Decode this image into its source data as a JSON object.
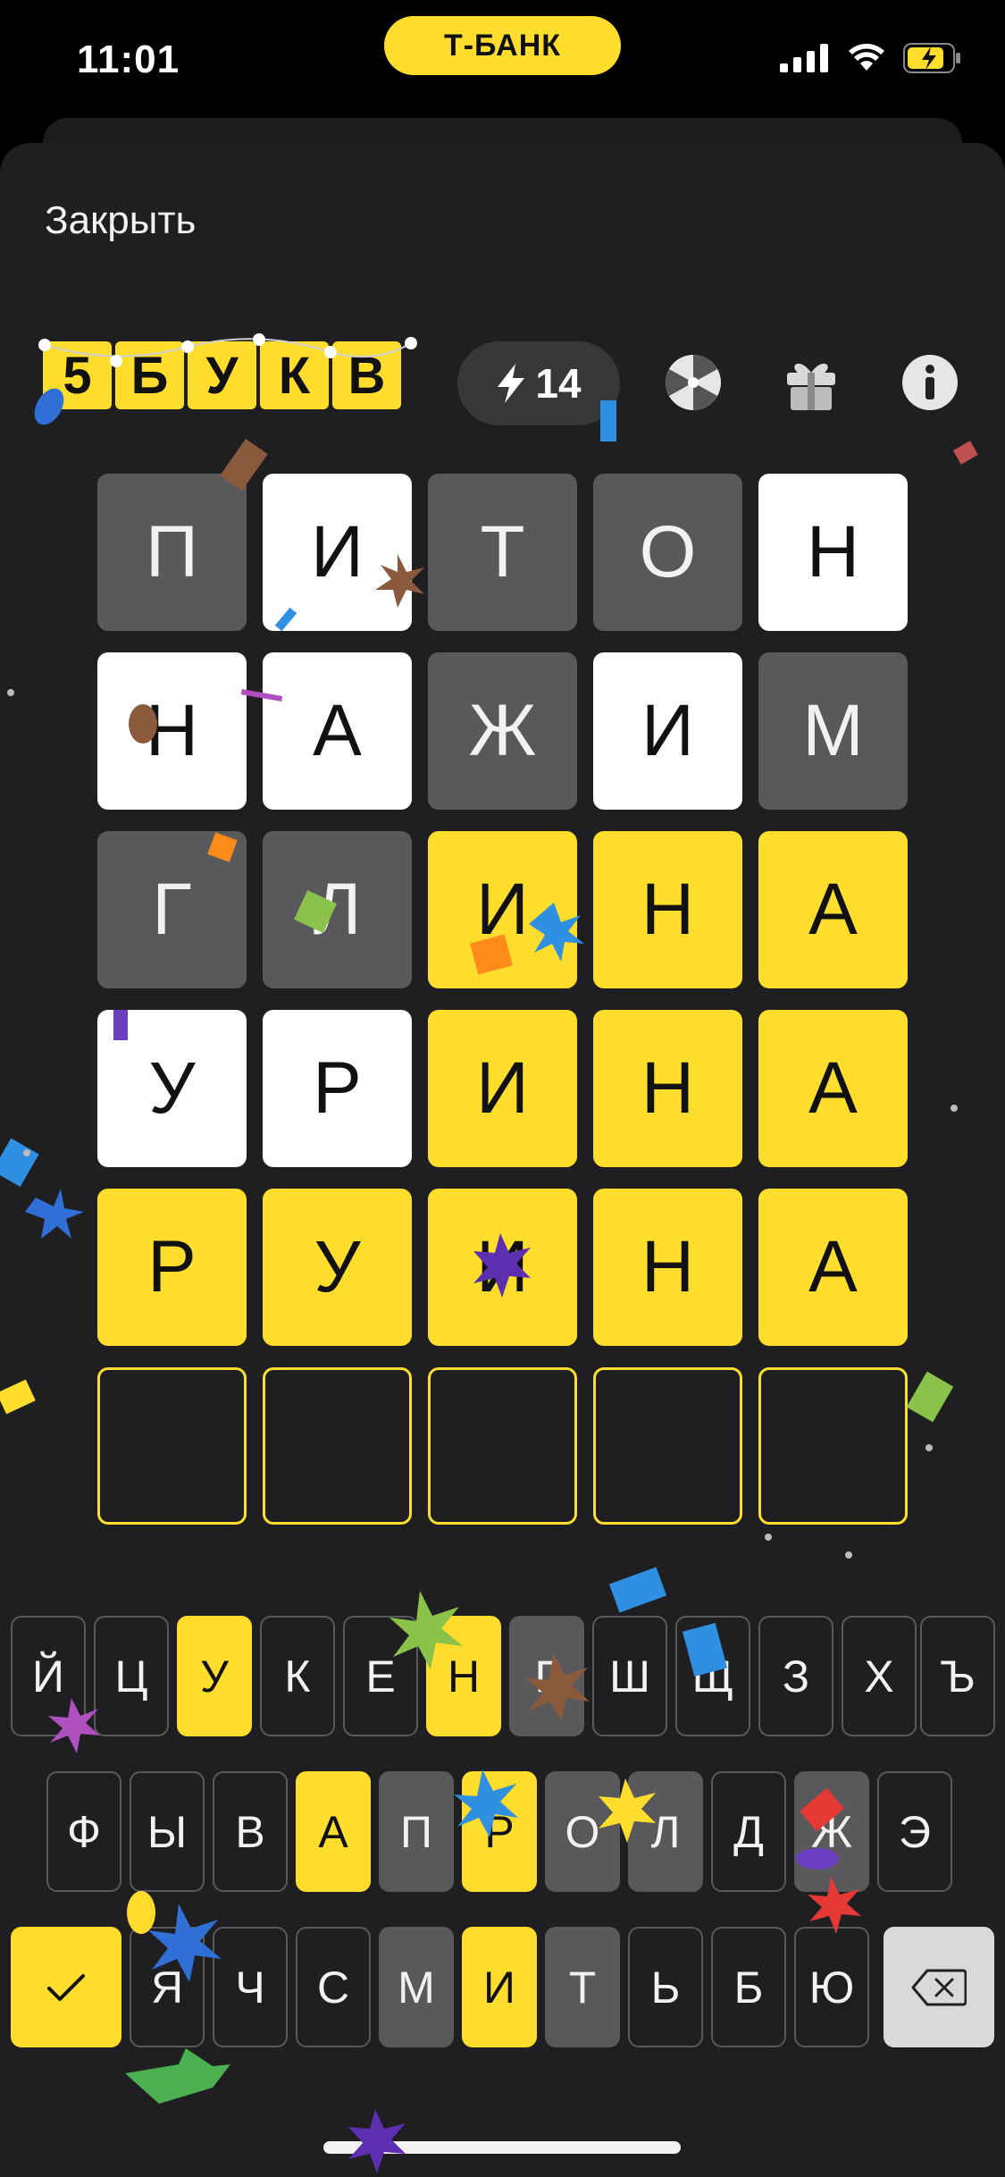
{
  "status_bar": {
    "time": "11:01",
    "bank_label": "Т-БАНК"
  },
  "sheet": {
    "close_label": "Закрыть"
  },
  "header": {
    "logo_letters": [
      "5",
      "Б",
      "У",
      "К",
      "В"
    ],
    "energy_count": "14"
  },
  "board": {
    "rows": [
      [
        {
          "letter": "П",
          "state": "gray"
        },
        {
          "letter": "И",
          "state": "white"
        },
        {
          "letter": "Т",
          "state": "gray"
        },
        {
          "letter": "О",
          "state": "gray"
        },
        {
          "letter": "Н",
          "state": "white"
        }
      ],
      [
        {
          "letter": "Н",
          "state": "white"
        },
        {
          "letter": "А",
          "state": "white"
        },
        {
          "letter": "Ж",
          "state": "gray"
        },
        {
          "letter": "И",
          "state": "white"
        },
        {
          "letter": "М",
          "state": "gray"
        }
      ],
      [
        {
          "letter": "Г",
          "state": "gray"
        },
        {
          "letter": "Л",
          "state": "gray"
        },
        {
          "letter": "И",
          "state": "yellow"
        },
        {
          "letter": "Н",
          "state": "yellow"
        },
        {
          "letter": "А",
          "state": "yellow"
        }
      ],
      [
        {
          "letter": "У",
          "state": "white"
        },
        {
          "letter": "Р",
          "state": "white"
        },
        {
          "letter": "И",
          "state": "yellow"
        },
        {
          "letter": "Н",
          "state": "yellow"
        },
        {
          "letter": "А",
          "state": "yellow"
        }
      ],
      [
        {
          "letter": "Р",
          "state": "yellow"
        },
        {
          "letter": "У",
          "state": "yellow"
        },
        {
          "letter": "И",
          "state": "yellow"
        },
        {
          "letter": "Н",
          "state": "yellow"
        },
        {
          "letter": "А",
          "state": "yellow"
        }
      ],
      [
        {
          "letter": "",
          "state": "empty"
        },
        {
          "letter": "",
          "state": "empty"
        },
        {
          "letter": "",
          "state": "empty"
        },
        {
          "letter": "",
          "state": "empty"
        },
        {
          "letter": "",
          "state": "empty"
        }
      ]
    ]
  },
  "keyboard": {
    "rows": [
      [
        {
          "label": "Й",
          "state": "normal"
        },
        {
          "label": "Ц",
          "state": "normal"
        },
        {
          "label": "У",
          "state": "yellow"
        },
        {
          "label": "К",
          "state": "normal"
        },
        {
          "label": "Е",
          "state": "normal"
        },
        {
          "label": "Н",
          "state": "yellow"
        },
        {
          "label": "Г",
          "state": "gray"
        },
        {
          "label": "Ш",
          "state": "normal"
        },
        {
          "label": "Щ",
          "state": "normal"
        },
        {
          "label": "З",
          "state": "normal"
        },
        {
          "label": "Х",
          "state": "normal"
        },
        {
          "label": "Ъ",
          "state": "normal"
        }
      ],
      [
        {
          "label": "Ф",
          "state": "normal"
        },
        {
          "label": "Ы",
          "state": "normal"
        },
        {
          "label": "В",
          "state": "normal"
        },
        {
          "label": "А",
          "state": "yellow"
        },
        {
          "label": "П",
          "state": "gray"
        },
        {
          "label": "Р",
          "state": "yellow"
        },
        {
          "label": "О",
          "state": "gray"
        },
        {
          "label": "Л",
          "state": "gray"
        },
        {
          "label": "Д",
          "state": "normal"
        },
        {
          "label": "Ж",
          "state": "gray"
        },
        {
          "label": "Э",
          "state": "normal"
        }
      ],
      [
        {
          "label": "✓",
          "state": "yellow",
          "role": "submit"
        },
        {
          "label": "Я",
          "state": "normal"
        },
        {
          "label": "Ч",
          "state": "normal"
        },
        {
          "label": "С",
          "state": "normal"
        },
        {
          "label": "М",
          "state": "gray"
        },
        {
          "label": "И",
          "state": "yellow"
        },
        {
          "label": "Т",
          "state": "gray"
        },
        {
          "label": "Ь",
          "state": "normal"
        },
        {
          "label": "Б",
          "state": "normal"
        },
        {
          "label": "Ю",
          "state": "normal"
        },
        {
          "label": "⌫",
          "state": "light",
          "role": "backspace"
        }
      ]
    ]
  },
  "icons": {
    "energy": "lightning-icon",
    "wheel": "wheel-icon",
    "gift": "gift-icon",
    "info": "info-icon"
  },
  "colors": {
    "accent_yellow": "#ffdd2d",
    "gray_tile": "#59595c",
    "sheet_bg": "#1f1f21"
  }
}
